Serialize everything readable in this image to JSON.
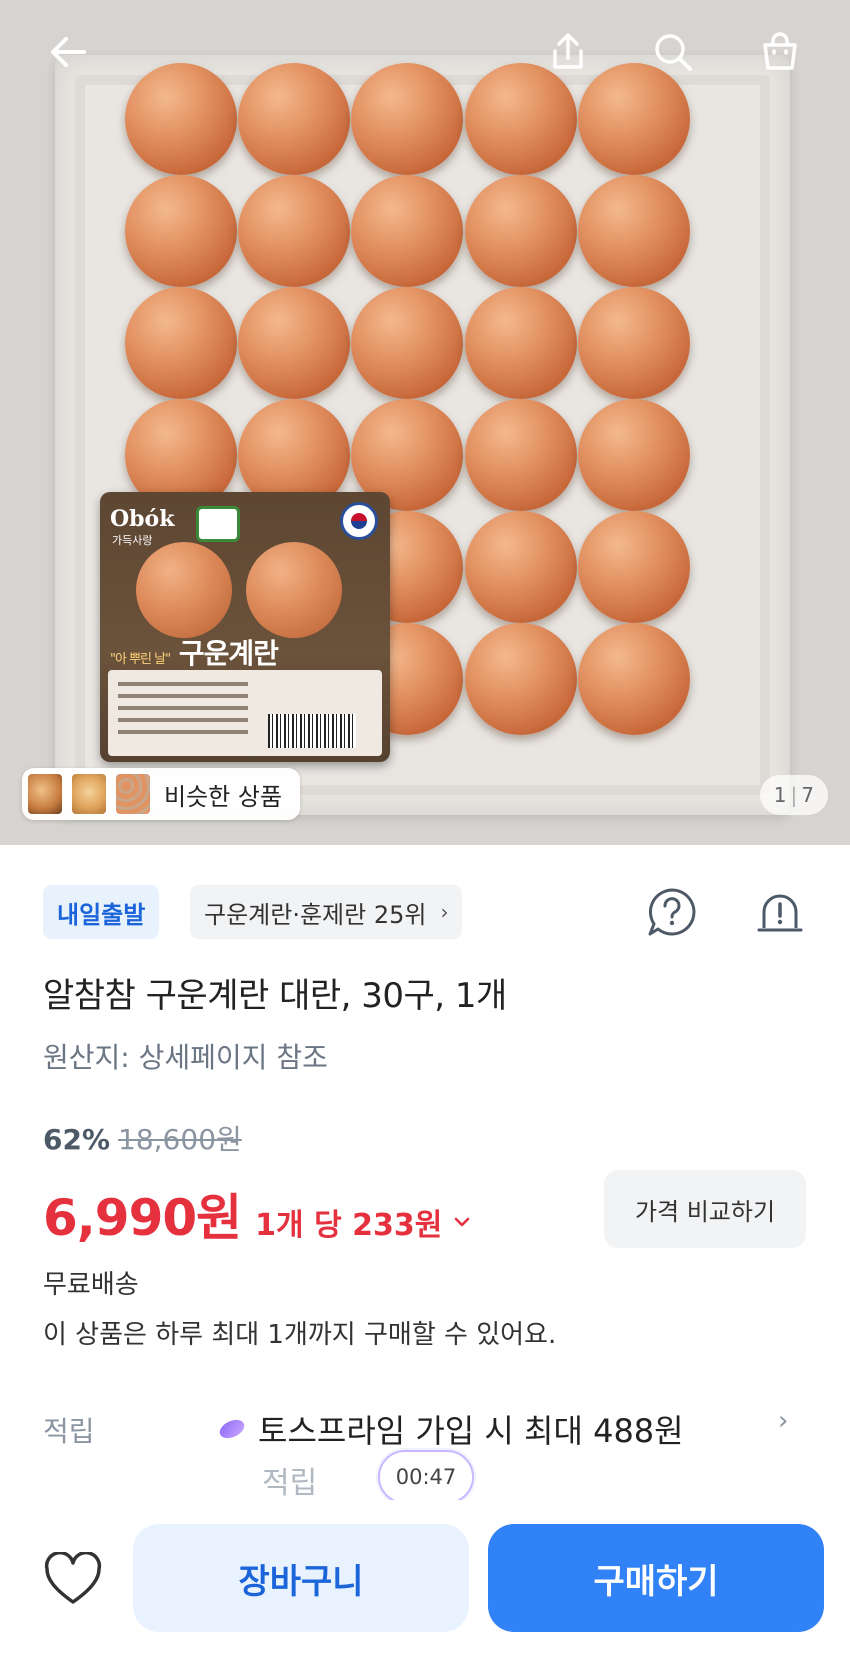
{
  "header": {
    "back_icon": "arrow-left-icon",
    "share_icon": "share-icon",
    "search_icon": "search-icon",
    "bag_icon": "shopping-bag-icon"
  },
  "gallery": {
    "similar_products_label": "비슷한 상품",
    "current_index": "1",
    "total": "7"
  },
  "product_photo_text": {
    "brand": "Obók",
    "brand_sub": "가득사랑",
    "name": "구운계란",
    "tagline": "\"아 뿌린 날\""
  },
  "badges": {
    "delivery": "내일출발",
    "ranking": "구운계란·훈제란 25위"
  },
  "product": {
    "title": "알참참 구운계란 대란, 30구, 1개",
    "origin": "원산지: 상세페이지 참조"
  },
  "pricing": {
    "discount": "62%",
    "original_price": "18,600원",
    "price": "6,990원",
    "unit_price": "1개 당 233원",
    "compare_label": "가격 비교하기"
  },
  "shipping": {
    "text": "무료배송",
    "purchase_limit": "이 상품은 하루 최대 1개까지 구매할 수 있어요."
  },
  "reward": {
    "label": "적립",
    "text": "토스프라임 가입 시 최대 488원",
    "text_cont": "적립"
  },
  "timer": "00:47",
  "actions": {
    "cart_label": "장바구니",
    "buy_label": "구매하기"
  },
  "colors": {
    "accent_blue": "#3182f6",
    "price_red": "#e5303e"
  }
}
